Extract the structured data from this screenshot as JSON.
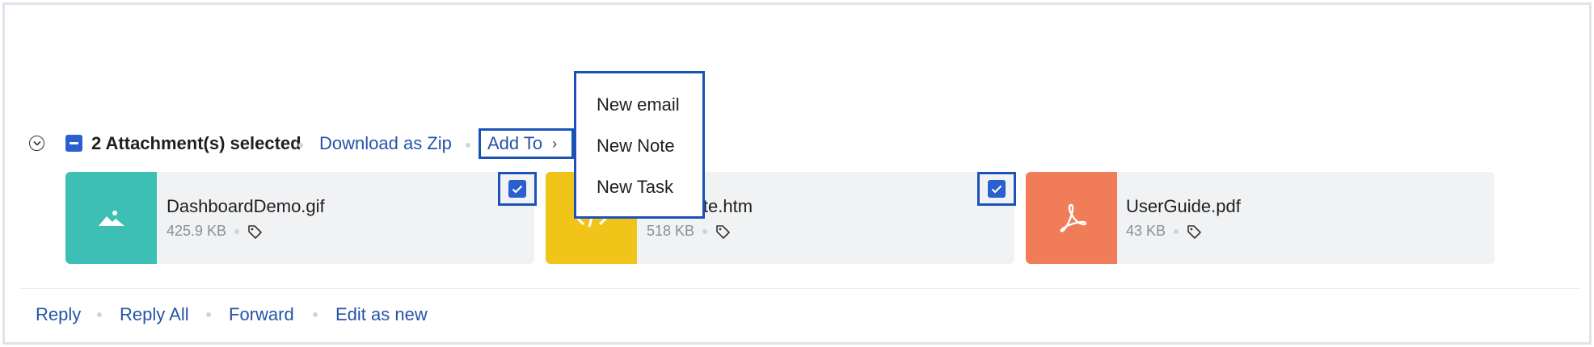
{
  "attachments_bar": {
    "selected_count_label": "2 Attachment(s) selected",
    "download_zip_label": "Download as Zip",
    "add_to_label": "Add To"
  },
  "add_to_menu": {
    "items": [
      {
        "label": "New email"
      },
      {
        "label": "New Note"
      },
      {
        "label": "New Task"
      }
    ]
  },
  "attachments": [
    {
      "name": "DashboardDemo.gif",
      "size": "425.9 KB",
      "color": "#3dbfb6",
      "icon": "image-icon",
      "selected": true
    },
    {
      "name": "Template.htm",
      "size": "518 KB",
      "color": "#f0c419",
      "icon": "code-icon",
      "selected": true
    },
    {
      "name": "UserGuide.pdf",
      "size": "43 KB",
      "color": "#f07c58",
      "icon": "pdf-icon",
      "selected": false
    }
  ],
  "message_actions": {
    "reply": "Reply",
    "reply_all": "Reply All",
    "forward": "Forward",
    "edit_as_new": "Edit as new"
  },
  "colors": {
    "accent": "#2a5fcf",
    "link": "#2553a8",
    "focus_outline": "#1a52b8"
  }
}
